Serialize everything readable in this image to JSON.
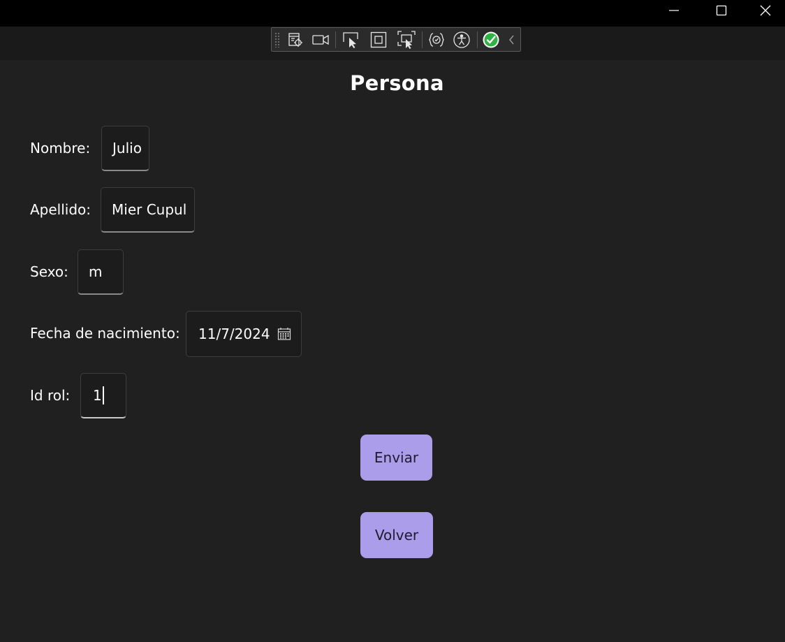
{
  "titlebar": {
    "minimize_icon": "minimize-icon",
    "maximize_icon": "maximize-icon",
    "close_icon": "close-icon"
  },
  "devtools": {
    "icons": [
      "live-visual-tree-icon",
      "record-icon",
      "select-element-icon",
      "display-layout-adorners-icon",
      "track-focus-icon",
      "binding-failures-icon",
      "accessibility-icon",
      "check-status-icon",
      "collapse-chevron-icon"
    ]
  },
  "page": {
    "title": "Persona"
  },
  "form": {
    "nombre_label": "Nombre:",
    "nombre_value": "Julio",
    "apellido_label": "Apellido:",
    "apellido_value": "Mier Cupul",
    "sexo_label": "Sexo:",
    "sexo_value": "m",
    "fecha_label": "Fecha de nacimiento:",
    "fecha_value": "11/7/2024",
    "idrol_label": "Id rol:",
    "idrol_value": "1"
  },
  "actions": {
    "enviar_label": "Enviar",
    "volver_label": "Volver"
  },
  "colors": {
    "background": "#202020",
    "titlebar": "#000000",
    "button_accent": "#ab9de9",
    "status_ok": "#2fb344"
  }
}
